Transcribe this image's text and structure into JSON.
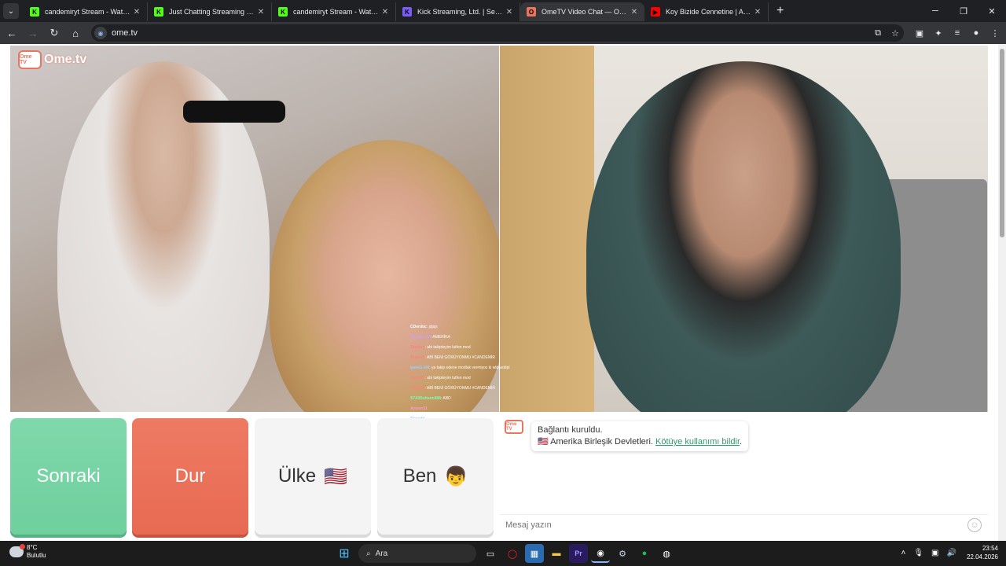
{
  "browser": {
    "tabs": [
      {
        "title": "candemiryt Stream - Watch Live",
        "fav": "K",
        "color": "#53fc18",
        "active": false
      },
      {
        "title": "Just Chatting Streaming - Live S",
        "fav": "K",
        "color": "#53fc18",
        "active": false
      },
      {
        "title": "candemiryt Stream - Watch Live",
        "fav": "K",
        "color": "#53fc18",
        "active": false
      },
      {
        "title": "Kick Streaming, Ltd. | Set up pay",
        "fav": "K",
        "color": "#7b5cf5",
        "active": false
      },
      {
        "title": "OmeTV Video Chat — Ome",
        "fav": "O",
        "color": "#e8765f",
        "active": true
      },
      {
        "title": "Koy Bizide Cennetine | Abdurra",
        "fav": "▶",
        "color": "#ff0000",
        "active": false
      }
    ],
    "url": "ome.tv"
  },
  "page": {
    "logo": "Ome.tv",
    "logo_badge": "Ome TV",
    "buttons": {
      "next": "Sonraki",
      "stop": "Dur",
      "country": "Ülke",
      "country_emoji": "🇺🇸",
      "me": "Ben",
      "me_emoji": "👦"
    },
    "chat": {
      "status": "Bağlantı kuruldu.",
      "country_flag": "🇺🇸",
      "country": "Amerika Birleşik Devletleri.",
      "report_link": "Kötüye kullanımı bildir",
      "input_placeholder": "Mesaj yazın"
    },
    "stream_chat": [
      {
        "user": "CDerdoc",
        "text": ": jdjsjx",
        "color": "#ffffff"
      },
      {
        "user": "20_Ege_20",
        "text": ": AMERİKA",
        "color": "#c9a0ff"
      },
      {
        "user": "Taşkent",
        "text": ": abi takipteyim lutfen mod",
        "color": "#ff8080"
      },
      {
        "user": "Taşkent",
        "text": ": ABİ BENİ GÖRÜYONMU #CANDEMİR",
        "color": "#ff8080"
      },
      {
        "user": "IpekiG.XM",
        "text": ": ya takip edene modluk vermiyoz ki wlqlwddpl",
        "color": "#9ad0ff"
      },
      {
        "user": "Taşkent",
        "text": ": abi takipteyim lutfen mod",
        "color": "#ff8080"
      },
      {
        "user": "Taşkent",
        "text": ": ABİ BENİ GÖRÜYONMU #CANDEMİR",
        "color": "#ff8080"
      },
      {
        "user": "S7A9Sultanc888",
        "text": ": ABD",
        "color": "#7dffb0"
      },
      {
        "user": "Ayiyen31",
        "text": "",
        "color": "#ff9ad0"
      },
      {
        "user": "Skoodd",
        "text": "",
        "color": "#9ad0ff"
      },
      {
        "user": "Ayiyen31",
        "text": "",
        "color": "#ff9ad0"
      },
      {
        "user": "Ayiyen31",
        "text": "",
        "color": "#ff9ad0"
      }
    ]
  },
  "taskbar": {
    "temperature": "8°C",
    "weather": "Bulutlu",
    "search": "Ara",
    "time": "23:54",
    "date": "22.04.2026"
  }
}
